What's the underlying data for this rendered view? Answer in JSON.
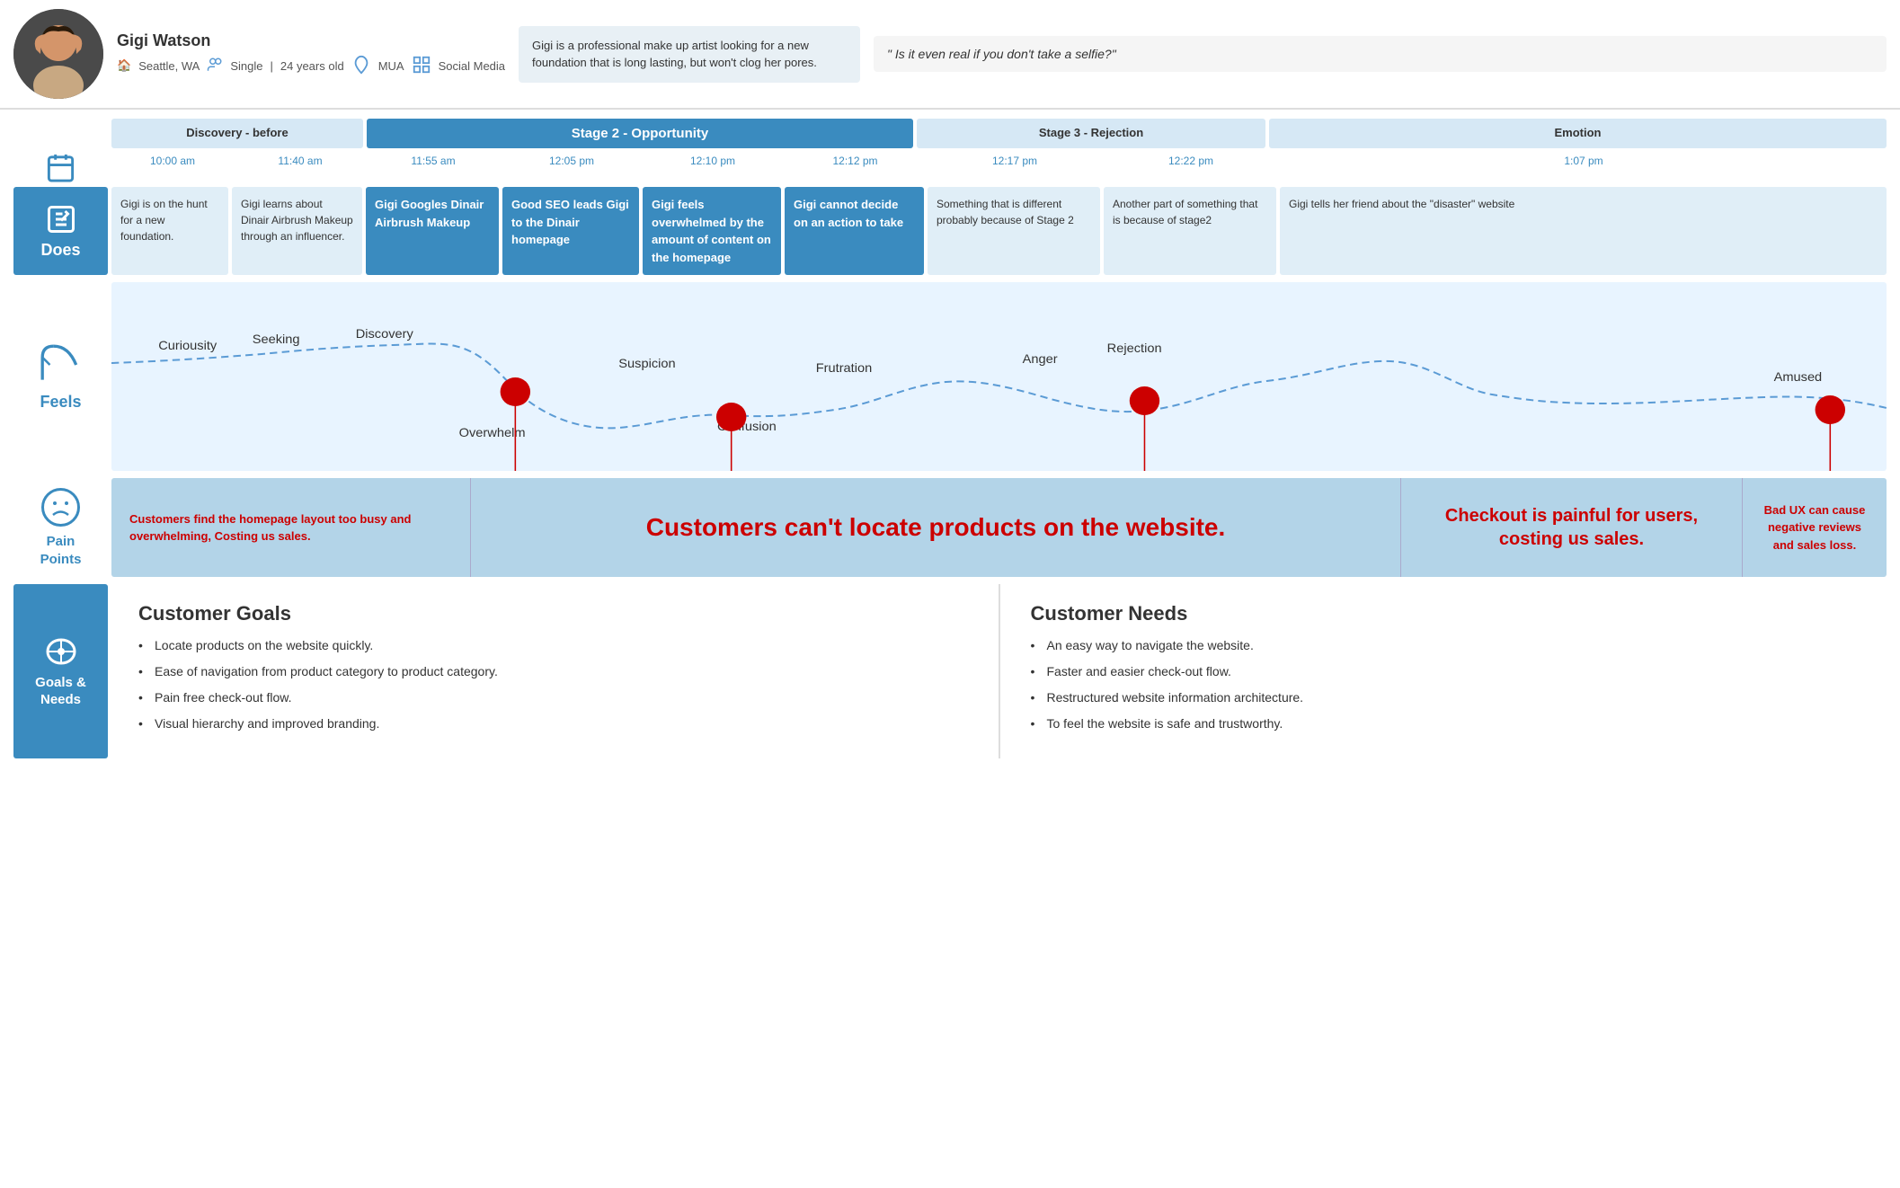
{
  "persona": {
    "name": "Gigi Watson",
    "location": "Seattle, WA",
    "status": "Single",
    "age": "24 years old",
    "occupation": "MUA",
    "social": "Social Media",
    "bio": "Gigi is a professional make up artist looking for a new foundation that is long lasting, but won't clog her pores.",
    "quote": "\" Is it even real if you don't take a selfie?\""
  },
  "stages": {
    "discovery": "Discovery - before",
    "opportunity": "Stage 2 - Opportunity",
    "rejection": "Stage 3 - Rejection",
    "emotion": "Emotion"
  },
  "times": {
    "t1": "10:00 am",
    "t2": "11:40 am",
    "t3": "11:55 am",
    "t4": "12:05 pm",
    "t5": "12:10 pm",
    "t6": "12:12 pm",
    "t7": "12:17 pm",
    "t8": "12:22 pm",
    "t9": "1:07 pm"
  },
  "does": {
    "d1": "Gigi is on the hunt for a new foundation.",
    "d2": "Gigi learns about Dinair Airbrush Makeup through an influencer.",
    "d3": "Gigi Googles Dinair Airbrush Makeup",
    "d4": "Good SEO leads Gigi to the Dinair homepage",
    "d5": "Gigi feels overwhelmed by the amount of content on the homepage",
    "d6": "Gigi cannot decide on an action to take",
    "d7": "Something that is different probably because of Stage 2",
    "d8": "Another part of something that is because of stage2",
    "d9": "Gigi tells her friend about the \"disaster\" website"
  },
  "feels": {
    "emotions": [
      "Curiousity",
      "Seeking",
      "Discovery",
      "Suspicion",
      "Confusion",
      "Frustration",
      "Anger",
      "Rejection",
      "Amused",
      "Overwhelm"
    ]
  },
  "painPoints": {
    "p1": "Customers find the homepage layout too busy and overwhelming, Costing us sales.",
    "p2": "Customers can't locate products on the website.",
    "p3": "Checkout is painful for users, costing us sales.",
    "p4": "Bad UX can cause negative reviews and sales loss."
  },
  "goals": {
    "title": "Customer Goals",
    "items": [
      "Locate products on the website quickly.",
      "Ease of navigation from product category to product category.",
      "Pain free check-out flow.",
      "Visual hierarchy and improved branding."
    ]
  },
  "needs": {
    "title": "Customer Needs",
    "items": [
      "An easy way to navigate the website.",
      "Faster and easier check-out flow.",
      "Restructured website information architecture.",
      "To feel the website is safe and trustworthy."
    ]
  },
  "rowLabels": {
    "does": "Does",
    "feels": "Feels",
    "painPoints": "Pain Points",
    "goalsNeeds": "Goals &\nNeeds"
  }
}
